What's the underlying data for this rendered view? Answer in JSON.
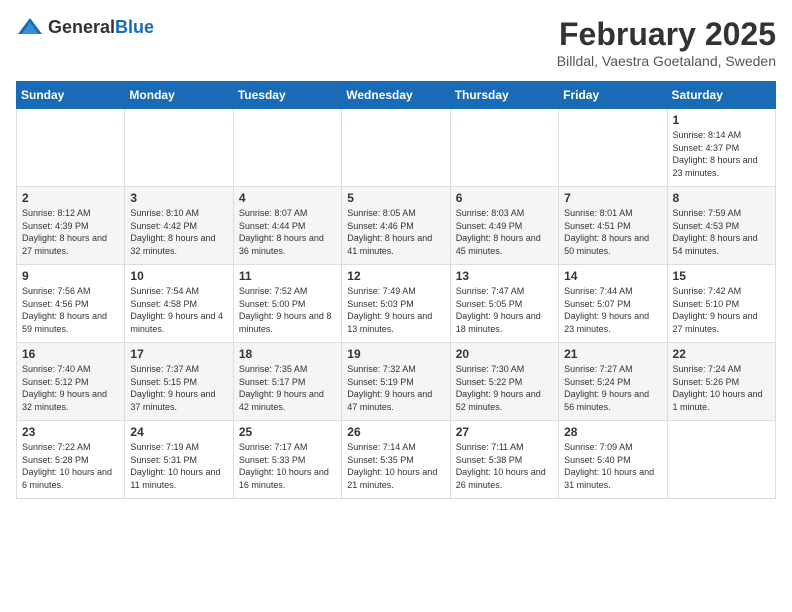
{
  "header": {
    "logo": {
      "text_general": "General",
      "text_blue": "Blue"
    },
    "title": "February 2025",
    "location": "Billdal, Vaestra Goetaland, Sweden"
  },
  "days_of_week": [
    "Sunday",
    "Monday",
    "Tuesday",
    "Wednesday",
    "Thursday",
    "Friday",
    "Saturday"
  ],
  "weeks": [
    [
      {
        "day": "",
        "info": ""
      },
      {
        "day": "",
        "info": ""
      },
      {
        "day": "",
        "info": ""
      },
      {
        "day": "",
        "info": ""
      },
      {
        "day": "",
        "info": ""
      },
      {
        "day": "",
        "info": ""
      },
      {
        "day": "1",
        "info": "Sunrise: 8:14 AM\nSunset: 4:37 PM\nDaylight: 8 hours and 23 minutes."
      }
    ],
    [
      {
        "day": "2",
        "info": "Sunrise: 8:12 AM\nSunset: 4:39 PM\nDaylight: 8 hours and 27 minutes."
      },
      {
        "day": "3",
        "info": "Sunrise: 8:10 AM\nSunset: 4:42 PM\nDaylight: 8 hours and 32 minutes."
      },
      {
        "day": "4",
        "info": "Sunrise: 8:07 AM\nSunset: 4:44 PM\nDaylight: 8 hours and 36 minutes."
      },
      {
        "day": "5",
        "info": "Sunrise: 8:05 AM\nSunset: 4:46 PM\nDaylight: 8 hours and 41 minutes."
      },
      {
        "day": "6",
        "info": "Sunrise: 8:03 AM\nSunset: 4:49 PM\nDaylight: 8 hours and 45 minutes."
      },
      {
        "day": "7",
        "info": "Sunrise: 8:01 AM\nSunset: 4:51 PM\nDaylight: 8 hours and 50 minutes."
      },
      {
        "day": "8",
        "info": "Sunrise: 7:59 AM\nSunset: 4:53 PM\nDaylight: 8 hours and 54 minutes."
      }
    ],
    [
      {
        "day": "9",
        "info": "Sunrise: 7:56 AM\nSunset: 4:56 PM\nDaylight: 8 hours and 59 minutes."
      },
      {
        "day": "10",
        "info": "Sunrise: 7:54 AM\nSunset: 4:58 PM\nDaylight: 9 hours and 4 minutes."
      },
      {
        "day": "11",
        "info": "Sunrise: 7:52 AM\nSunset: 5:00 PM\nDaylight: 9 hours and 8 minutes."
      },
      {
        "day": "12",
        "info": "Sunrise: 7:49 AM\nSunset: 5:03 PM\nDaylight: 9 hours and 13 minutes."
      },
      {
        "day": "13",
        "info": "Sunrise: 7:47 AM\nSunset: 5:05 PM\nDaylight: 9 hours and 18 minutes."
      },
      {
        "day": "14",
        "info": "Sunrise: 7:44 AM\nSunset: 5:07 PM\nDaylight: 9 hours and 23 minutes."
      },
      {
        "day": "15",
        "info": "Sunrise: 7:42 AM\nSunset: 5:10 PM\nDaylight: 9 hours and 27 minutes."
      }
    ],
    [
      {
        "day": "16",
        "info": "Sunrise: 7:40 AM\nSunset: 5:12 PM\nDaylight: 9 hours and 32 minutes."
      },
      {
        "day": "17",
        "info": "Sunrise: 7:37 AM\nSunset: 5:15 PM\nDaylight: 9 hours and 37 minutes."
      },
      {
        "day": "18",
        "info": "Sunrise: 7:35 AM\nSunset: 5:17 PM\nDaylight: 9 hours and 42 minutes."
      },
      {
        "day": "19",
        "info": "Sunrise: 7:32 AM\nSunset: 5:19 PM\nDaylight: 9 hours and 47 minutes."
      },
      {
        "day": "20",
        "info": "Sunrise: 7:30 AM\nSunset: 5:22 PM\nDaylight: 9 hours and 52 minutes."
      },
      {
        "day": "21",
        "info": "Sunrise: 7:27 AM\nSunset: 5:24 PM\nDaylight: 9 hours and 56 minutes."
      },
      {
        "day": "22",
        "info": "Sunrise: 7:24 AM\nSunset: 5:26 PM\nDaylight: 10 hours and 1 minute."
      }
    ],
    [
      {
        "day": "23",
        "info": "Sunrise: 7:22 AM\nSunset: 5:28 PM\nDaylight: 10 hours and 6 minutes."
      },
      {
        "day": "24",
        "info": "Sunrise: 7:19 AM\nSunset: 5:31 PM\nDaylight: 10 hours and 11 minutes."
      },
      {
        "day": "25",
        "info": "Sunrise: 7:17 AM\nSunset: 5:33 PM\nDaylight: 10 hours and 16 minutes."
      },
      {
        "day": "26",
        "info": "Sunrise: 7:14 AM\nSunset: 5:35 PM\nDaylight: 10 hours and 21 minutes."
      },
      {
        "day": "27",
        "info": "Sunrise: 7:11 AM\nSunset: 5:38 PM\nDaylight: 10 hours and 26 minutes."
      },
      {
        "day": "28",
        "info": "Sunrise: 7:09 AM\nSunset: 5:40 PM\nDaylight: 10 hours and 31 minutes."
      },
      {
        "day": "",
        "info": ""
      }
    ]
  ]
}
